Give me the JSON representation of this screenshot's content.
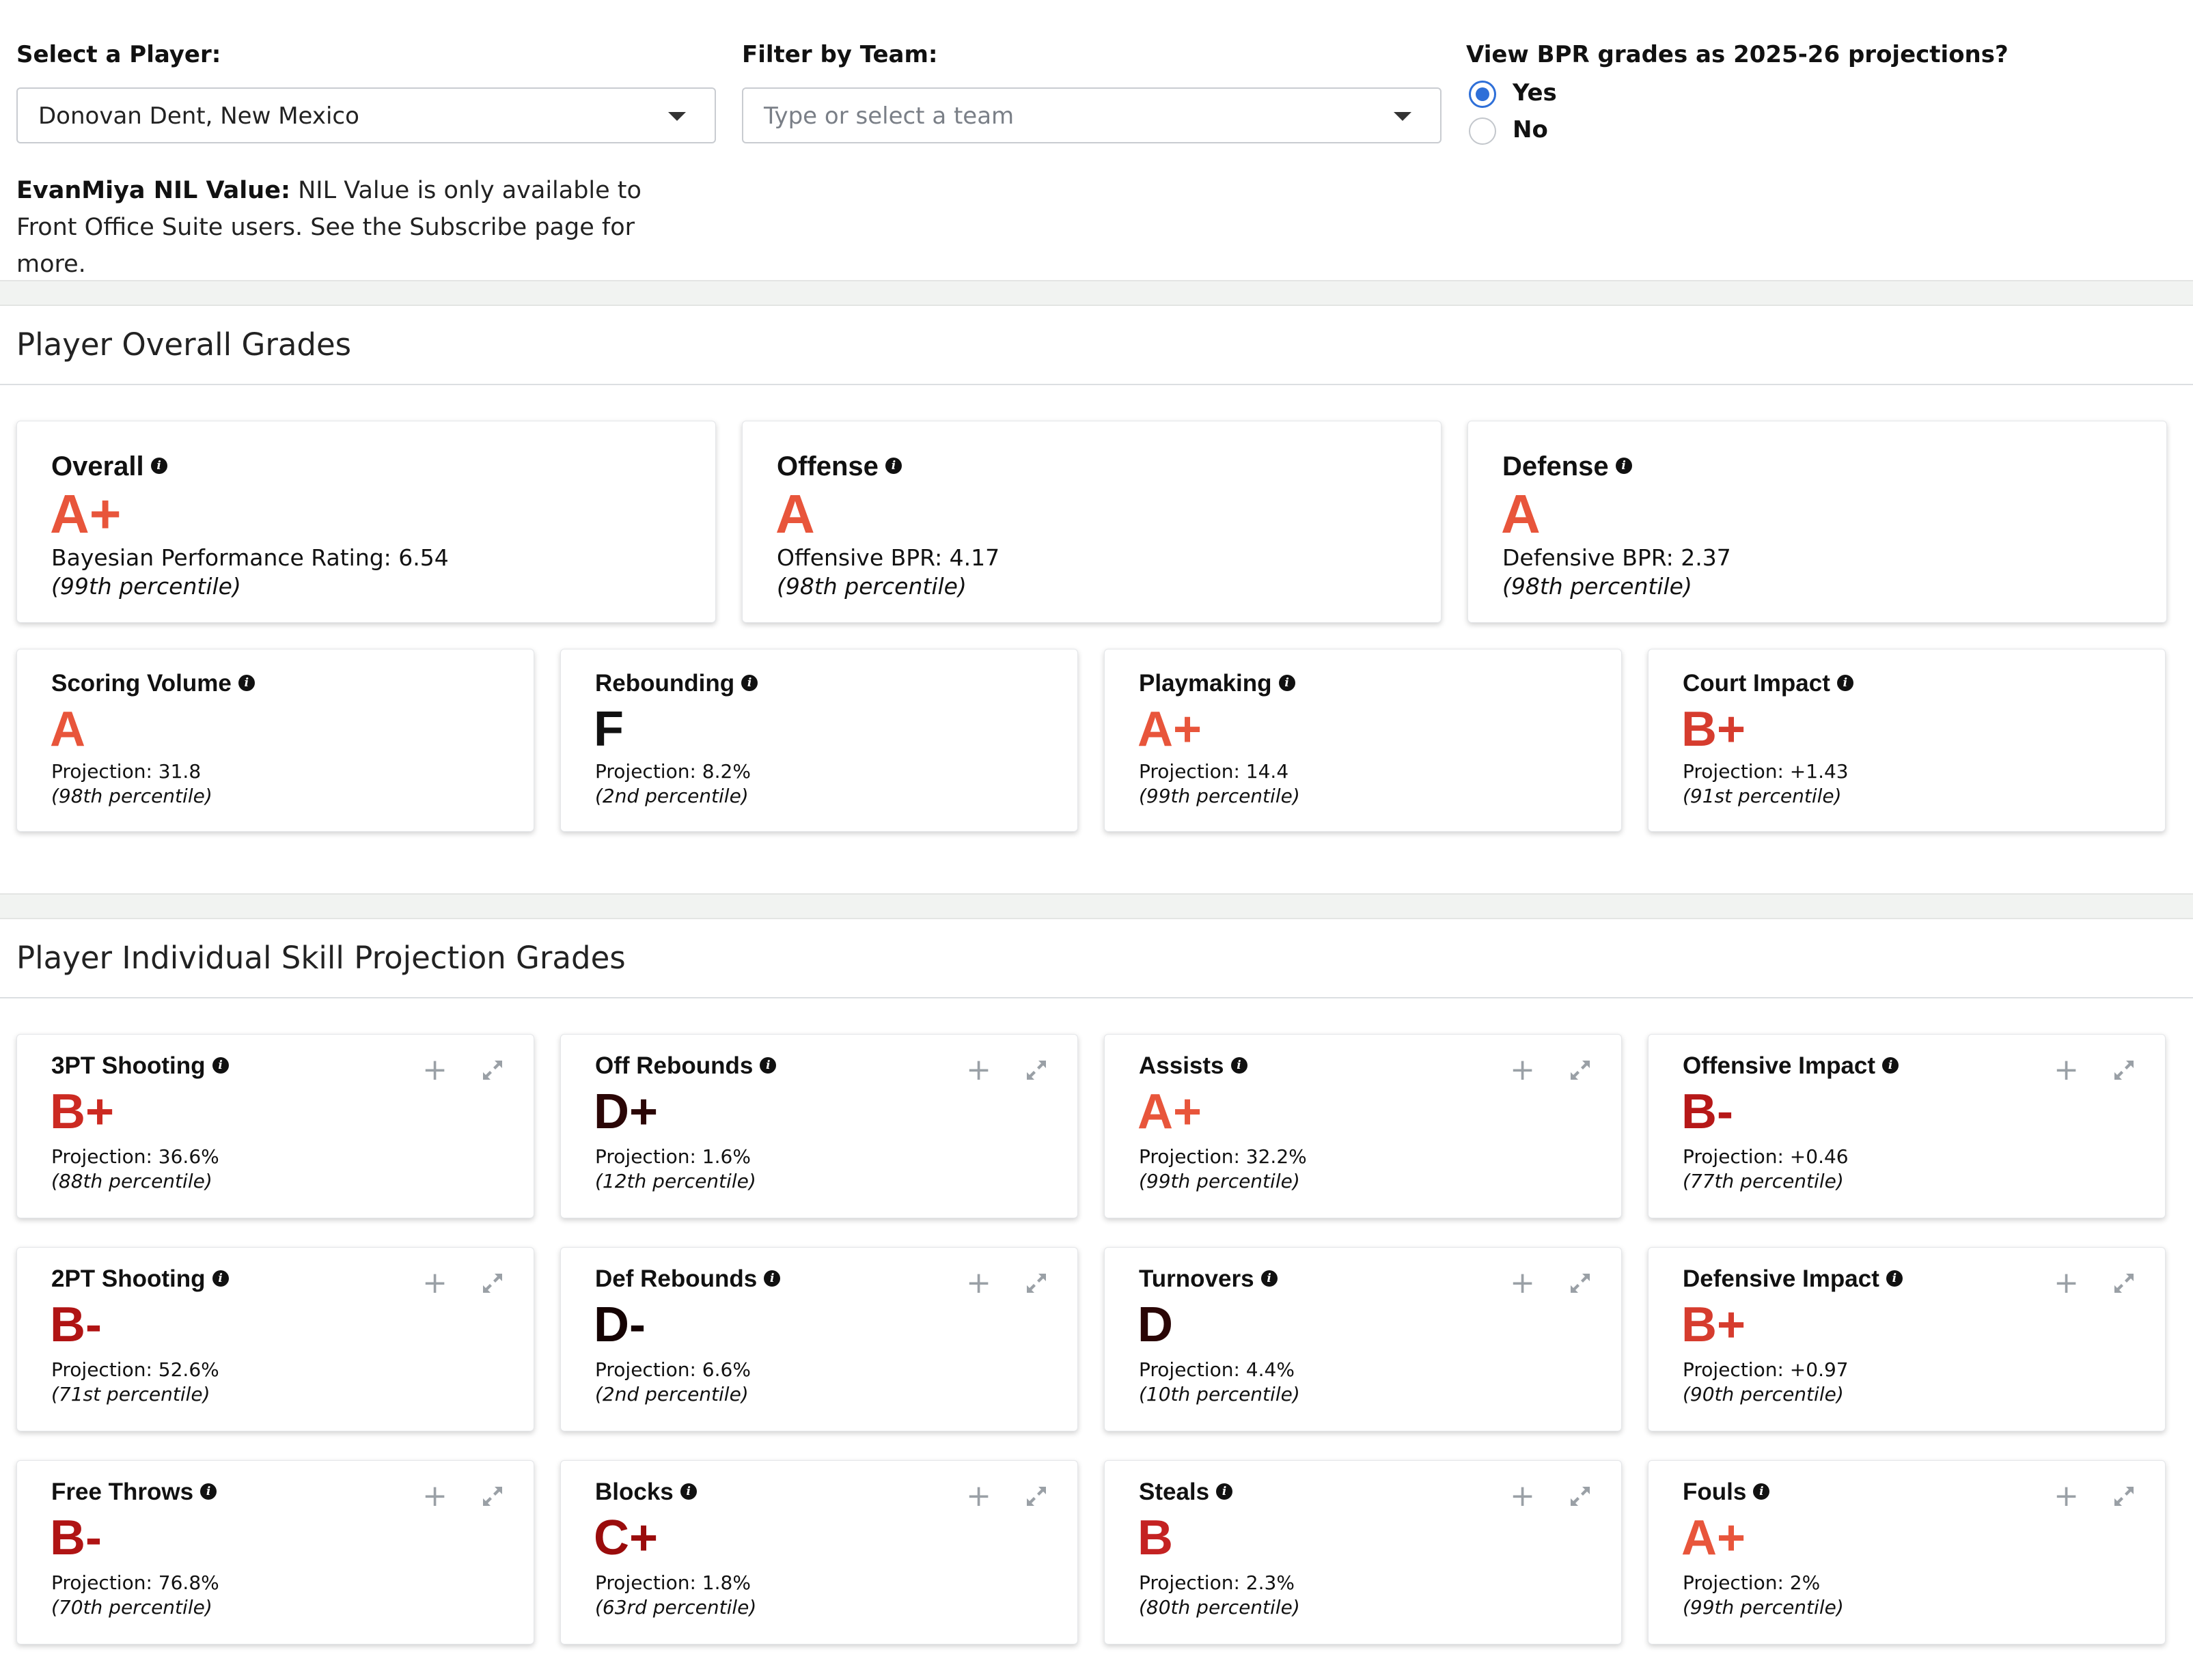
{
  "controls": {
    "player_label": "Select a Player:",
    "player_value": "Donovan Dent, New Mexico",
    "team_label": "Filter by Team:",
    "team_placeholder": "Type or select a team",
    "projection_question": "View BPR grades as 2025-26 projections?",
    "radio_yes": "Yes",
    "radio_no": "No",
    "radio_selected": "Yes"
  },
  "nil": {
    "label": "EvanMiya NIL Value:",
    "text": "NIL Value is only available to Front Office Suite users. See the Subscribe page for more."
  },
  "overall_section": {
    "title": "Player Overall Grades",
    "main_cards": [
      {
        "title": "Overall",
        "grade": "A+",
        "color": "#e8553b",
        "line1": "Bayesian Performance Rating: 6.54",
        "line2": "(99th percentile)"
      },
      {
        "title": "Offense",
        "grade": "A",
        "color": "#e8553b",
        "line1": "Offensive BPR: 4.17",
        "line2": "(98th percentile)"
      },
      {
        "title": "Defense",
        "grade": "A",
        "color": "#e8553b",
        "line1": "Defensive BPR: 2.37",
        "line2": "(98th percentile)"
      }
    ],
    "sub_cards": [
      {
        "title": "Scoring Volume",
        "grade": "A",
        "color": "#e8553b",
        "line1": "Projection: 31.8",
        "line2": "(98th percentile)"
      },
      {
        "title": "Rebounding",
        "grade": "F",
        "color": "#111111",
        "line1": "Projection: 8.2%",
        "line2": "(2nd percentile)"
      },
      {
        "title": "Playmaking",
        "grade": "A+",
        "color": "#e8553b",
        "line1": "Projection: 14.4",
        "line2": "(99th percentile)"
      },
      {
        "title": "Court Impact",
        "grade": "B+",
        "color": "#d63c2e",
        "line1": "Projection: +1.43",
        "line2": "(91st percentile)"
      }
    ]
  },
  "skills_section": {
    "title": "Player Individual Skill Projection Grades",
    "rows": [
      [
        {
          "title": "3PT Shooting",
          "grade": "B+",
          "color": "#cc2a22",
          "line1": "Projection: 36.6%",
          "line2": "(88th percentile)"
        },
        {
          "title": "Off Rebounds",
          "grade": "D+",
          "color": "#2b0606",
          "line1": "Projection: 1.6%",
          "line2": "(12th percentile)"
        },
        {
          "title": "Assists",
          "grade": "A+",
          "color": "#e8553b",
          "line1": "Projection: 32.2%",
          "line2": "(99th percentile)"
        },
        {
          "title": "Offensive Impact",
          "grade": "B-",
          "color": "#b61818",
          "line1": "Projection: +0.46",
          "line2": "(77th percentile)"
        }
      ],
      [
        {
          "title": "2PT Shooting",
          "grade": "B-",
          "color": "#b01414",
          "line1": "Projection: 52.6%",
          "line2": "(71st percentile)"
        },
        {
          "title": "Def Rebounds",
          "grade": "D-",
          "color": "#150303",
          "line1": "Projection: 6.6%",
          "line2": "(2nd percentile)"
        },
        {
          "title": "Turnovers",
          "grade": "D",
          "color": "#2a0606",
          "line1": "Projection: 4.4%",
          "line2": "(10th percentile)"
        },
        {
          "title": "Defensive Impact",
          "grade": "B+",
          "color": "#d63c2e",
          "line1": "Projection: +0.97",
          "line2": "(90th percentile)"
        }
      ],
      [
        {
          "title": "Free Throws",
          "grade": "B-",
          "color": "#b01414",
          "line1": "Projection: 76.8%",
          "line2": "(70th percentile)"
        },
        {
          "title": "Blocks",
          "grade": "C+",
          "color": "#9a0c0c",
          "line1": "Projection: 1.8%",
          "line2": "(63rd percentile)"
        },
        {
          "title": "Steals",
          "grade": "B",
          "color": "#c42222",
          "line1": "Projection: 2.3%",
          "line2": "(80th percentile)"
        },
        {
          "title": "Fouls",
          "grade": "A+",
          "color": "#e8553b",
          "line1": "Projection: 2%",
          "line2": "(99th percentile)"
        }
      ]
    ]
  }
}
